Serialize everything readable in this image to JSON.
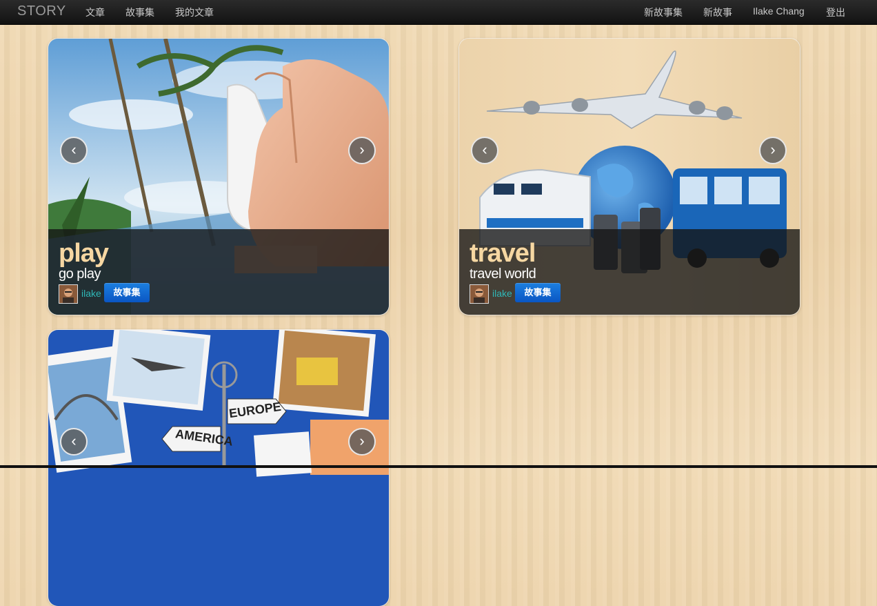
{
  "navbar": {
    "brand": "STORY",
    "left_items": [
      "文章",
      "故事集",
      "我的文章"
    ],
    "right_items": [
      "新故事集",
      "新故事",
      "Ilake Chang",
      "登出"
    ]
  },
  "cards": [
    {
      "title": "play",
      "subtitle": "go play",
      "user": "ilake",
      "badge": "故事集"
    },
    {
      "title": "travel",
      "subtitle": "travel world",
      "user": "ilake",
      "badge": "故事集"
    },
    {
      "sign_texts": [
        "EUROPE",
        "AMERICA"
      ]
    }
  ],
  "arrows": {
    "prev": "‹",
    "next": "›"
  },
  "colors": {
    "caption_title": "#f6d7a2",
    "username": "#2fb7b7",
    "badge": "#0a56c4",
    "navbar": "#1a1a1a"
  }
}
